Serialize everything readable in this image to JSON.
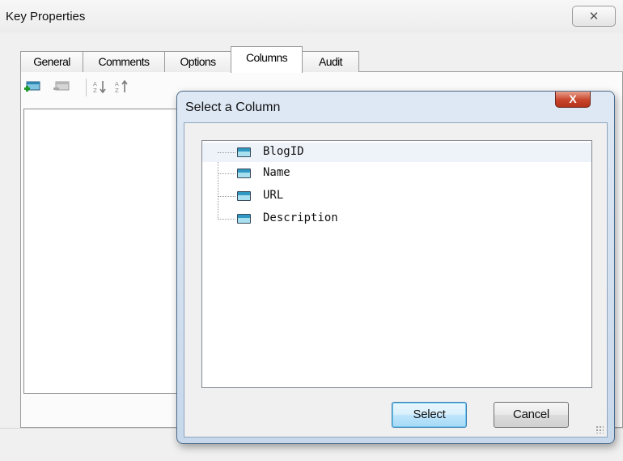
{
  "window": {
    "title": "Key Properties",
    "close_label": "✕"
  },
  "tabs": [
    {
      "label": "General"
    },
    {
      "label": "Comments"
    },
    {
      "label": "Options"
    },
    {
      "label": "Columns",
      "active": true
    },
    {
      "label": "Audit"
    }
  ],
  "toolbar": {
    "icons": [
      "add-column-icon",
      "remove-column-icon",
      "sort-ascending-icon",
      "sort-descending-icon"
    ]
  },
  "dialog": {
    "title": "Select a Column",
    "close_label": "X",
    "columns": [
      {
        "name": "BlogID",
        "selected": true
      },
      {
        "name": "Name"
      },
      {
        "name": "URL"
      },
      {
        "name": "Description"
      }
    ],
    "select_label": "Select",
    "cancel_label": "Cancel"
  },
  "colors": {
    "dialog_frame": "#c7d8eb",
    "close_button": "#c9442b",
    "selection": "#eef3fa"
  }
}
